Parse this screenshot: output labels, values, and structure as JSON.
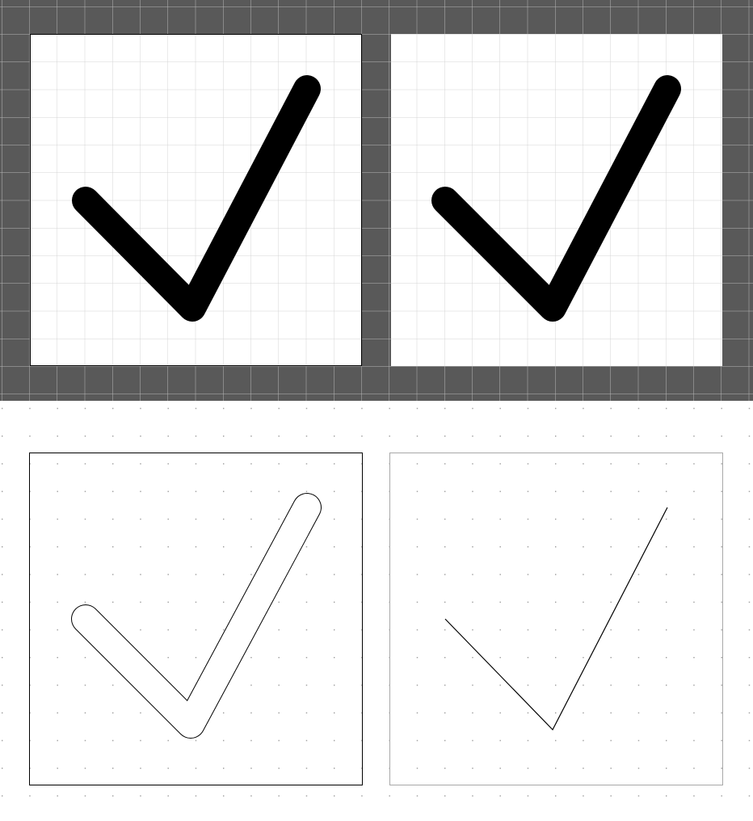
{
  "canvas": {
    "top_background": "#595959",
    "top_grid_line": "#b8b8b8",
    "panel_fill": "#ffffff",
    "panel_grid_line": "#d4d4d4",
    "panel_border_dark": "#000000",
    "panel_border_light": "#a8a8a8",
    "bottom_background": "#ffffff",
    "dot_color": "#9a9a9a",
    "ink": "#000000"
  },
  "glyph": {
    "name": "checkmark-icon"
  },
  "panels": [
    {
      "name": "filled-checkmark-bordered",
      "render": "filled"
    },
    {
      "name": "filled-checkmark-plain",
      "render": "filled"
    },
    {
      "name": "outline-checkmark",
      "render": "outline"
    },
    {
      "name": "centerline-checkmark",
      "render": "centerline"
    }
  ]
}
